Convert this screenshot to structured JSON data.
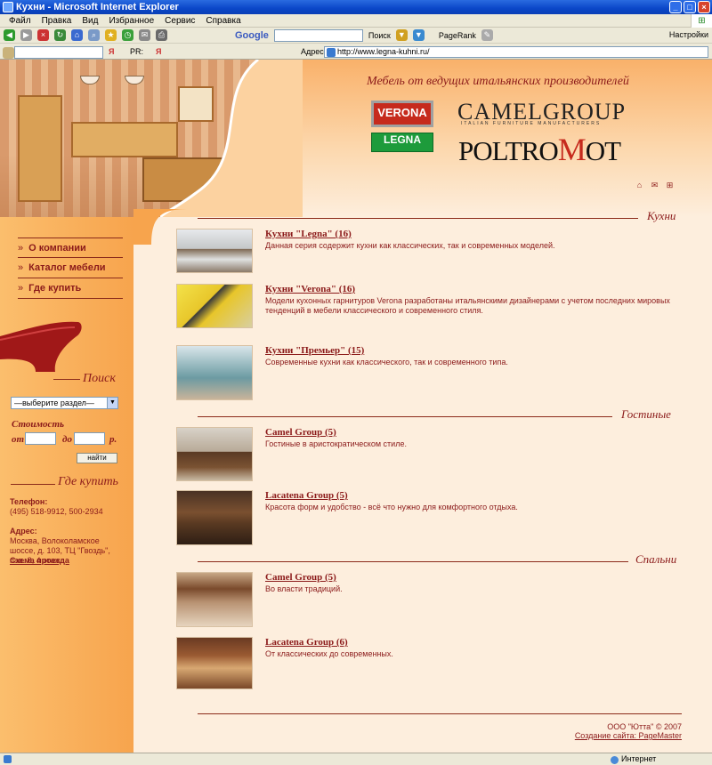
{
  "window": {
    "title": "Кухни - Microsoft Internet Explorer"
  },
  "menubar": [
    "Файл",
    "Правка",
    "Вид",
    "Избранное",
    "Сервис",
    "Справка"
  ],
  "toolbar": {
    "google": "Google",
    "search_label": "Поиск",
    "pagerank": "PageRank",
    "settings": "Настройки",
    "pr": "PR:"
  },
  "address": {
    "label": "Адрес:",
    "url": "http://www.legna-kuhni.ru/"
  },
  "status": {
    "zone": "Интернет"
  },
  "header": {
    "slogan": "Мебель от ведущих итальянских производителей",
    "logos": {
      "verona": "VERONA",
      "legna": "LEGNA",
      "camel": "CAMELGROUP",
      "camel_sub": "ITALIAN FURNITURE MANUFACTURERS",
      "poltro_a": "POLTRO",
      "poltro_m": "M",
      "poltro_b": "OT"
    }
  },
  "nav": {
    "items": [
      {
        "label": "О компании"
      },
      {
        "label": "Каталог мебели"
      },
      {
        "label": "Где купить"
      }
    ]
  },
  "search": {
    "title": "Поиск",
    "select_value": "—выберите раздел—",
    "price_label": "Стоимость",
    "from_label": "от",
    "to_label": "до",
    "currency": "р.",
    "button": "найти"
  },
  "where": {
    "title": "Где купить",
    "phone_label": "Телефон:",
    "phone": "(495) 518-9912, 500-2934",
    "address_label": "Адрес:",
    "address": "Москва, Волоколамское шоссе, д. 103, ТЦ \"Гвоздь\", пав. 8, 4 этаж",
    "map_link": "Схема проезда"
  },
  "categories": [
    {
      "title": "Кухни",
      "items": [
        {
          "title": "Кухни \"Legna\" (16)",
          "desc": "Данная серия содержит кухни как классических, так и современных моделей."
        },
        {
          "title": "Кухни \"Verona\" (16)",
          "desc": "Модели кухонных гарнитуров Verona разработаны итальянскими дизайнерами с учетом последних мировых тенденций в мебели классического и современного стиля."
        },
        {
          "title": "Кухни \"Премьер\" (15)",
          "desc": "Современные кухни как классического, так и современного типа."
        }
      ]
    },
    {
      "title": "Гостиные",
      "items": [
        {
          "title": "Camel Group (5)",
          "desc": "Гостиные в аристократическом стиле."
        },
        {
          "title": "Lacatena Group (5)",
          "desc": "Красота форм и удобство - всё что нужно для комфортного отдыха."
        }
      ]
    },
    {
      "title": "Спальни",
      "items": [
        {
          "title": "Camel Group (5)",
          "desc": "Во власти традиций."
        },
        {
          "title": "Lacatena Group (6)",
          "desc": "От классических до современных."
        }
      ]
    }
  ],
  "footer": {
    "copyright": "ООО \"Ютта\" © 2007",
    "developer": "Создание сайта: PageMaster"
  },
  "colors": {
    "accent": "#8b1a1a",
    "sidebar": "#f7a44d",
    "page_bg": "#fdeedd"
  }
}
